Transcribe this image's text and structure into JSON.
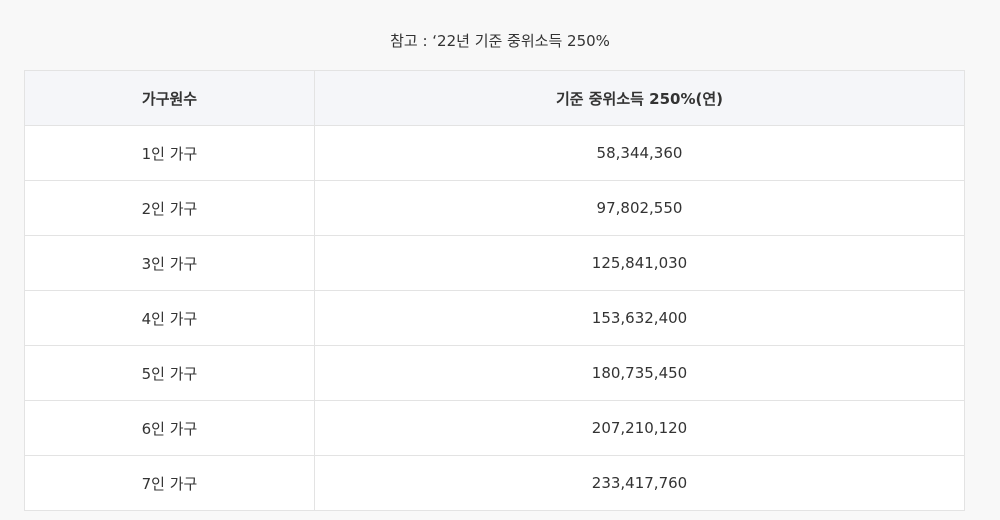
{
  "note": "참고 : ‘22년 기준 중위소득 250%",
  "table": {
    "headers": [
      "가구원수",
      "기준 중위소득 250%(연)"
    ],
    "rows": [
      [
        "1인 가구",
        "58,344,360"
      ],
      [
        "2인 가구",
        "97,802,550"
      ],
      [
        "3인 가구",
        "125,841,030"
      ],
      [
        "4인 가구",
        "153,632,400"
      ],
      [
        "5인 가구",
        "180,735,450"
      ],
      [
        "6인 가구",
        "207,210,120"
      ],
      [
        "7인 가구",
        "233,417,760"
      ]
    ]
  }
}
